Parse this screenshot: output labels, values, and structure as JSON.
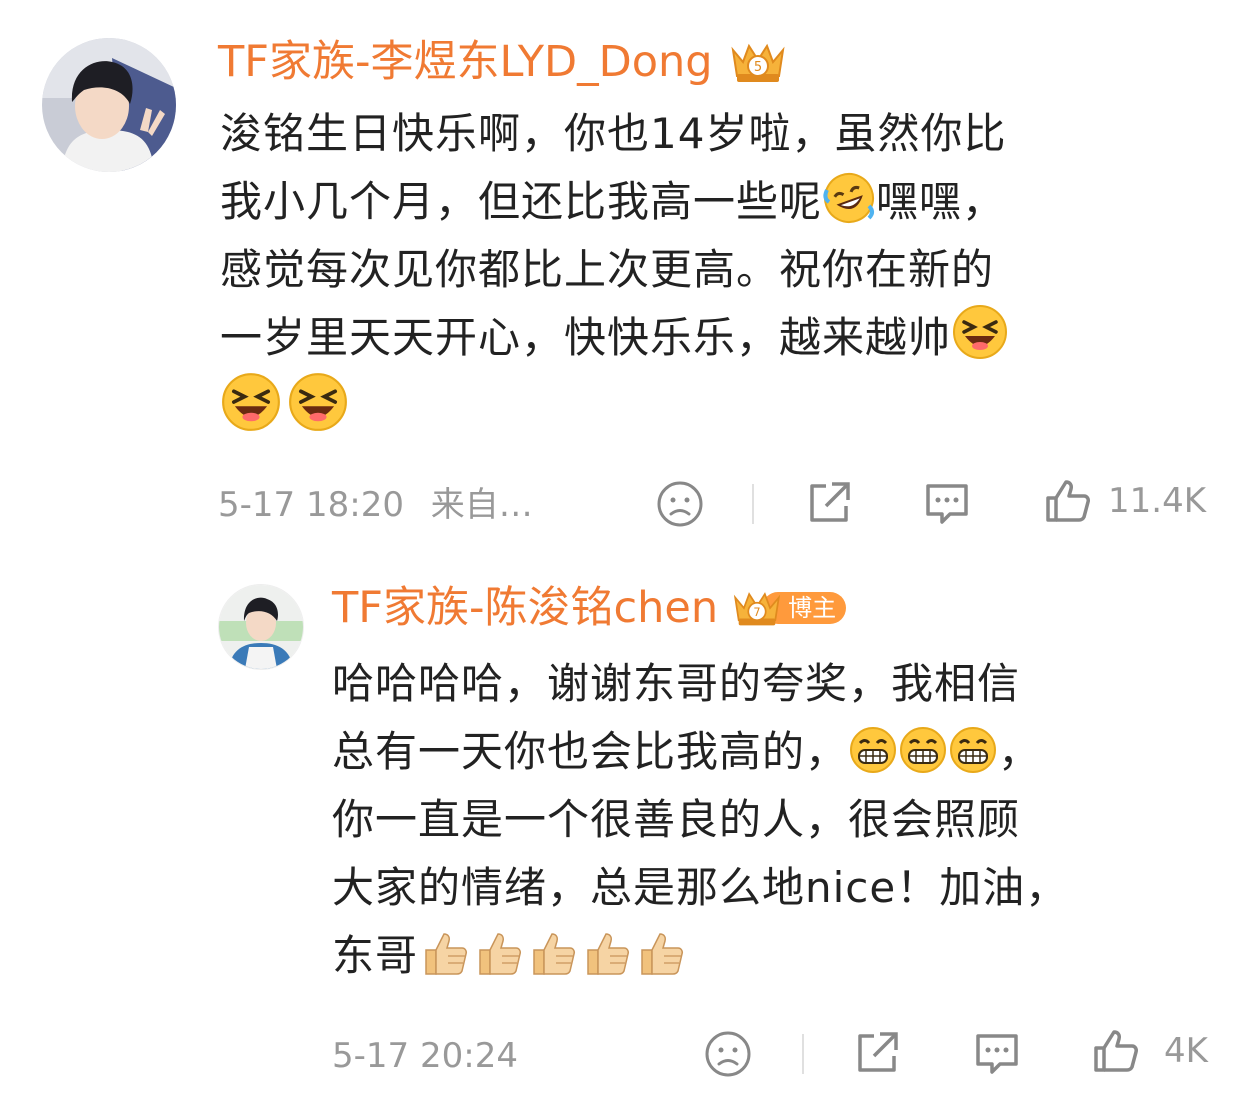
{
  "comment": {
    "author": "TF家族-李煜东LYD_Dong",
    "badge_level": "5",
    "lines": [
      "浚铭生日快乐啊，你也14岁啦，虽然你比",
      "我小几个月，但还比我高一些呢",
      "感觉每次见你都比上次更高。祝你在新的",
      "一岁里天天开心，快快乐乐，越来越帅",
      ""
    ],
    "line2_tail": "嘿嘿，",
    "timestamp": "5-17 18:20",
    "source": "来自…",
    "like_count": "11.4K",
    "icons": [
      "dislike-icon",
      "share-icon",
      "comment-icon",
      "like-icon"
    ]
  },
  "reply": {
    "author": "TF家族-陈浚铭chen",
    "badge_level": "7",
    "host_label": "博主",
    "lines": [
      "哈哈哈哈，谢谢东哥的夸奖，我相信",
      "总有一天你也会比我高的，",
      "你一直是一个很善良的人，很会照顾",
      "大家的情绪，总是那么地nice！加油，",
      "东哥"
    ],
    "line2_tail": "，",
    "timestamp": "5-17 20:24",
    "like_count": "4K"
  },
  "colors": {
    "name": "#f07a33",
    "meta": "#999999",
    "text": "#222222",
    "host_tag": "#ff9a3c"
  }
}
